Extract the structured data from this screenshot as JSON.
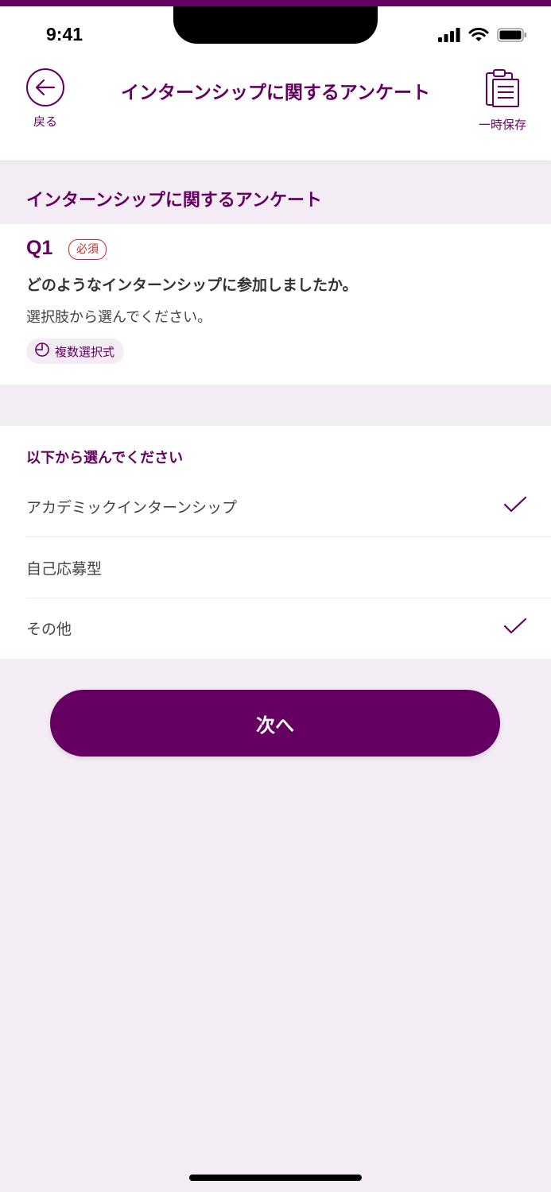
{
  "status_bar": {
    "time": "9:41"
  },
  "header": {
    "back_label": "戻る",
    "title": "インターンシップに関するアンケート",
    "save_label": "一時保存"
  },
  "section": {
    "title": "インターンシップに関するアンケート"
  },
  "question": {
    "number": "Q1",
    "required_label": "必須",
    "text": "どのようなインターンシップに参加しましたか。",
    "instruction": "選択肢から選んでください。",
    "type_label": "複数選択式"
  },
  "options": {
    "heading": "以下から選んでください",
    "items": [
      {
        "label": "アカデミックインターンシップ",
        "selected": true
      },
      {
        "label": "自己応募型",
        "selected": false
      },
      {
        "label": "その他",
        "selected": true
      }
    ]
  },
  "next_button": {
    "label": "次へ"
  },
  "colors": {
    "accent": "#650062",
    "background": "#f4ecf4",
    "required": "#d1262b"
  }
}
